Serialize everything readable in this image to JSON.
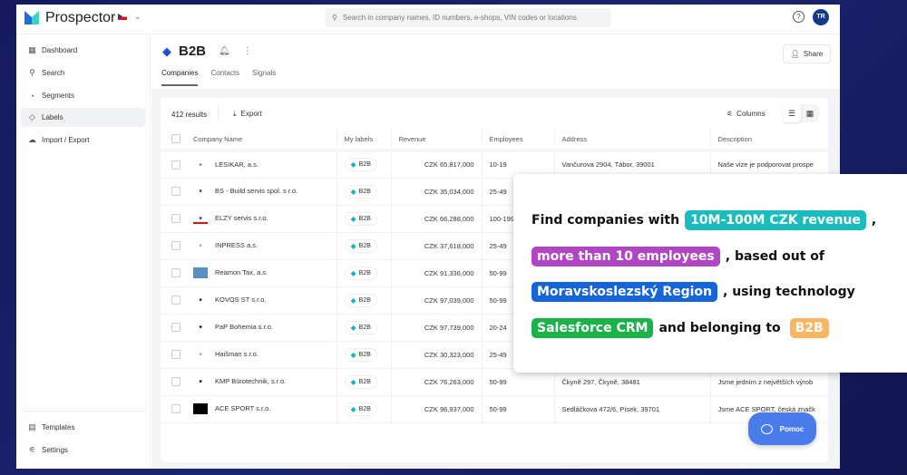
{
  "app": {
    "name": "Prospector",
    "search_placeholder": "Search in company names, ID numbers, e-shops, VIN codes or locations",
    "avatar_initials": "TR"
  },
  "sidebar": {
    "items": [
      {
        "label": "Dashboard",
        "icon": "grid-icon"
      },
      {
        "label": "Search",
        "icon": "search-icon"
      },
      {
        "label": "Segments",
        "icon": "pie-icon"
      },
      {
        "label": "Labels",
        "icon": "tag-icon",
        "active": true
      },
      {
        "label": "Import / Export",
        "icon": "cloud-icon"
      }
    ],
    "bottom": [
      {
        "label": "Templates"
      },
      {
        "label": "Settings"
      }
    ]
  },
  "page": {
    "title": "B2B",
    "share_label": "Share",
    "tabs": [
      "Companies",
      "Contacts",
      "Signals"
    ]
  },
  "toolbar": {
    "results": "412 results",
    "export": "Export",
    "columns": "Columns"
  },
  "table": {
    "headers": [
      "Company Name",
      "My labels",
      "Revenue",
      "Employees",
      "Address",
      "Description"
    ],
    "rows": [
      {
        "name": "LESIKAR, a.s.",
        "label": "B2B",
        "revenue": "CZK 65,817,000",
        "employees": "10-19",
        "address": "Vančurova 2904, Tábor, 39001",
        "description": "Naše vize je podporovat prospe"
      },
      {
        "name": "BS - Build servis spol. s r.o.",
        "label": "B2B",
        "revenue": "CZK 35,034,000",
        "employees": "25-49",
        "address": "",
        "description": ""
      },
      {
        "name": "ELZY servis s.r.o.",
        "label": "B2B",
        "revenue": "CZK 66,288,000",
        "employees": "100-199",
        "address": "",
        "description": ""
      },
      {
        "name": "INPRESS a.s.",
        "label": "B2B",
        "revenue": "CZK 37,618,000",
        "employees": "25-49",
        "address": "",
        "description": ""
      },
      {
        "name": "Reamon Tax, a.s.",
        "label": "B2B",
        "revenue": "CZK 91,336,000",
        "employees": "50-99",
        "address": "",
        "description": ""
      },
      {
        "name": "KOVOS ST s.r.o.",
        "label": "B2B",
        "revenue": "CZK 97,039,000",
        "employees": "50-99",
        "address": "",
        "description": ""
      },
      {
        "name": "PaP Bohemia s.r.o.",
        "label": "B2B",
        "revenue": "CZK 97,739,000",
        "employees": "20-24",
        "address": "",
        "description": ""
      },
      {
        "name": "Haišman s.r.o.",
        "label": "B2B",
        "revenue": "CZK 30,323,000",
        "employees": "25-49",
        "address": "",
        "description": ""
      },
      {
        "name": "KMP Bürotechnik, s.r.o.",
        "label": "B2B",
        "revenue": "CZK 76,263,000",
        "employees": "50-99",
        "address": "Čkyně 297, Čkyně, 38481",
        "description": "Jsme jedním z největších výrob"
      },
      {
        "name": "ACE SPORT s.r.o.",
        "label": "B2B",
        "revenue": "CZK 96,937,000",
        "employees": "50-99",
        "address": "Sedláčkova 472/6, Písek, 39701",
        "description": "Jsme ACE SPORT, česká značk"
      }
    ]
  },
  "promo": {
    "l1a": "Find companies with",
    "chip1": "10M-100M CZK revenue",
    "l1b": ",",
    "chip2": "more than 10 employees",
    "l2b": ", based out of",
    "chip3": "Moravskoslezský Region",
    "l3b": ", using technology",
    "chip4": "Salesforce CRM",
    "l4b": "and belonging to",
    "chip5": "B2B",
    "colors": {
      "chip1": "#1bbcbc",
      "chip2": "#b146c2",
      "chip3": "#1565d8",
      "chip4": "#1bb24a",
      "chip5": "#fbb462"
    }
  },
  "help_button": "Pomoc"
}
